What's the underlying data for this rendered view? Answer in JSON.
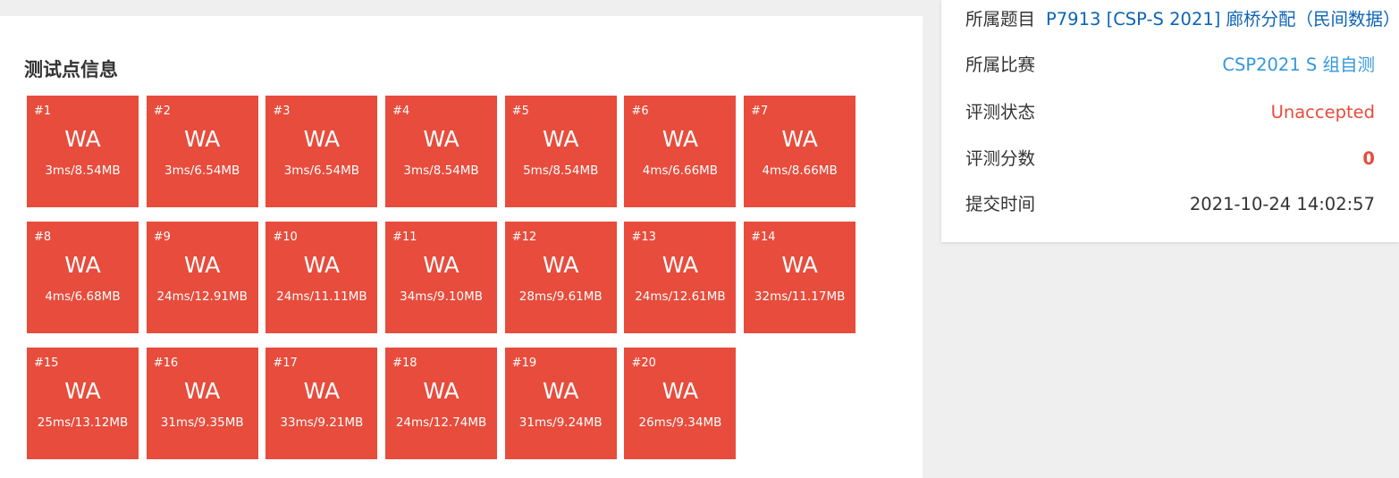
{
  "colors": {
    "tile_bg": "#e74c3c",
    "link_dark": "#0e64b5",
    "link_light": "#3498db",
    "unaccepted": "#e74c3c",
    "text": "#333333"
  },
  "testcases": {
    "title": "测试点信息",
    "items": [
      {
        "num": "#1",
        "status": "WA",
        "usage": "3ms/8.54MB"
      },
      {
        "num": "#2",
        "status": "WA",
        "usage": "3ms/6.54MB"
      },
      {
        "num": "#3",
        "status": "WA",
        "usage": "3ms/6.54MB"
      },
      {
        "num": "#4",
        "status": "WA",
        "usage": "3ms/8.54MB"
      },
      {
        "num": "#5",
        "status": "WA",
        "usage": "5ms/8.54MB"
      },
      {
        "num": "#6",
        "status": "WA",
        "usage": "4ms/6.66MB"
      },
      {
        "num": "#7",
        "status": "WA",
        "usage": "4ms/8.66MB"
      },
      {
        "num": "#8",
        "status": "WA",
        "usage": "4ms/6.68MB"
      },
      {
        "num": "#9",
        "status": "WA",
        "usage": "24ms/12.91MB"
      },
      {
        "num": "#10",
        "status": "WA",
        "usage": "24ms/11.11MB"
      },
      {
        "num": "#11",
        "status": "WA",
        "usage": "34ms/9.10MB"
      },
      {
        "num": "#12",
        "status": "WA",
        "usage": "28ms/9.61MB"
      },
      {
        "num": "#13",
        "status": "WA",
        "usage": "24ms/12.61MB"
      },
      {
        "num": "#14",
        "status": "WA",
        "usage": "32ms/11.17MB"
      },
      {
        "num": "#15",
        "status": "WA",
        "usage": "25ms/13.12MB"
      },
      {
        "num": "#16",
        "status": "WA",
        "usage": "31ms/9.35MB"
      },
      {
        "num": "#17",
        "status": "WA",
        "usage": "33ms/9.21MB"
      },
      {
        "num": "#18",
        "status": "WA",
        "usage": "24ms/12.74MB"
      },
      {
        "num": "#19",
        "status": "WA",
        "usage": "31ms/9.24MB"
      },
      {
        "num": "#20",
        "status": "WA",
        "usage": "26ms/9.34MB"
      }
    ]
  },
  "submission": {
    "problem_label": "所属题目",
    "problem_value": "P7913 [CSP-S 2021] 廊桥分配（民间数据）",
    "contest_label": "所属比赛",
    "contest_value": "CSP2021 S 组自测",
    "status_label": "评测状态",
    "status_value": "Unaccepted",
    "score_label": "评测分数",
    "score_value": "0",
    "time_label": "提交时间",
    "time_value": "2021-10-24 14:02:57"
  }
}
